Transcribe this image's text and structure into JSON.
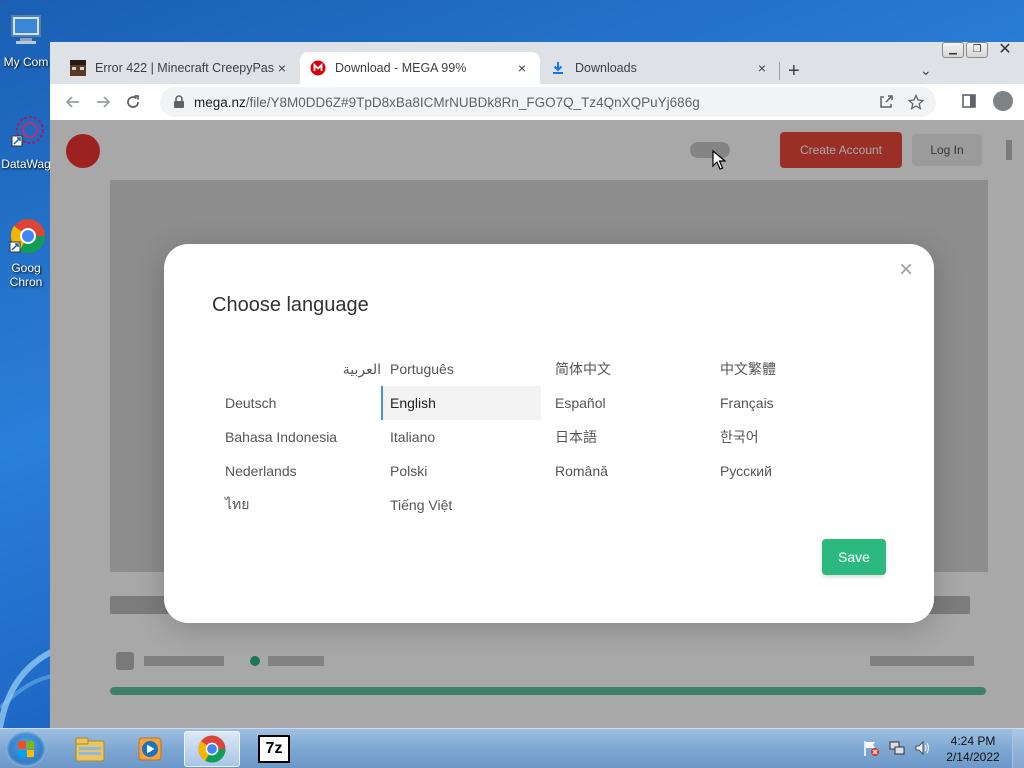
{
  "desktop": {
    "icons": [
      {
        "label": "My Com",
        "icon": "computer-icon"
      },
      {
        "label": "DataWag",
        "icon": "datawag-shortcut-icon"
      },
      {
        "label": "Goog",
        "icon": "chrome-shortcut-icon"
      },
      {
        "label": "Chron",
        "icon": "chrome-shortcut-icon"
      }
    ]
  },
  "browser": {
    "tabs": [
      {
        "title": "Error 422 | Minecraft CreepyPasta",
        "icon": "minecraft-favicon",
        "close": "×"
      },
      {
        "title": "Download - MEGA 99%",
        "icon": "mega-favicon",
        "close": "×",
        "active": true
      },
      {
        "title": "Downloads",
        "icon": "download-icon",
        "close": "×"
      }
    ],
    "new_tab": "+",
    "tab_search": "⌄",
    "url": {
      "host": "mega.nz",
      "path": "/file/Y8M0DD6Z#9TpD8xBa8ICMrNUBDk8Rn_FGO7Q_Tz4QnXQPuYj686g"
    }
  },
  "mega_page": {
    "header": {
      "create_account": "Create Account",
      "login": "Log In"
    }
  },
  "dialog": {
    "title": "Choose language",
    "close_glyph": "×",
    "languages": [
      "العربية",
      "Português",
      "简体中文",
      "中文繁體",
      "Deutsch",
      "English",
      "Español",
      "Français",
      "Bahasa Indonesia",
      "Italiano",
      "日本語",
      "한국어",
      "Nederlands",
      "Polski",
      "Română",
      "Русский",
      "ไทย",
      "Tiếng Việt"
    ],
    "selected": "English",
    "save_label": "Save"
  },
  "taskbar": {
    "pinned": [
      "explorer-icon",
      "media-player-icon",
      "chrome-icon",
      "7zip-icon"
    ],
    "active": "chrome-icon",
    "seven_zip_label": "7z",
    "clock": {
      "time": "4:24 PM",
      "date": "2/14/2022"
    }
  },
  "colors": {
    "save_button": "#2cb980",
    "selected_border": "#4a90e2",
    "mega_red": "#e33333"
  }
}
